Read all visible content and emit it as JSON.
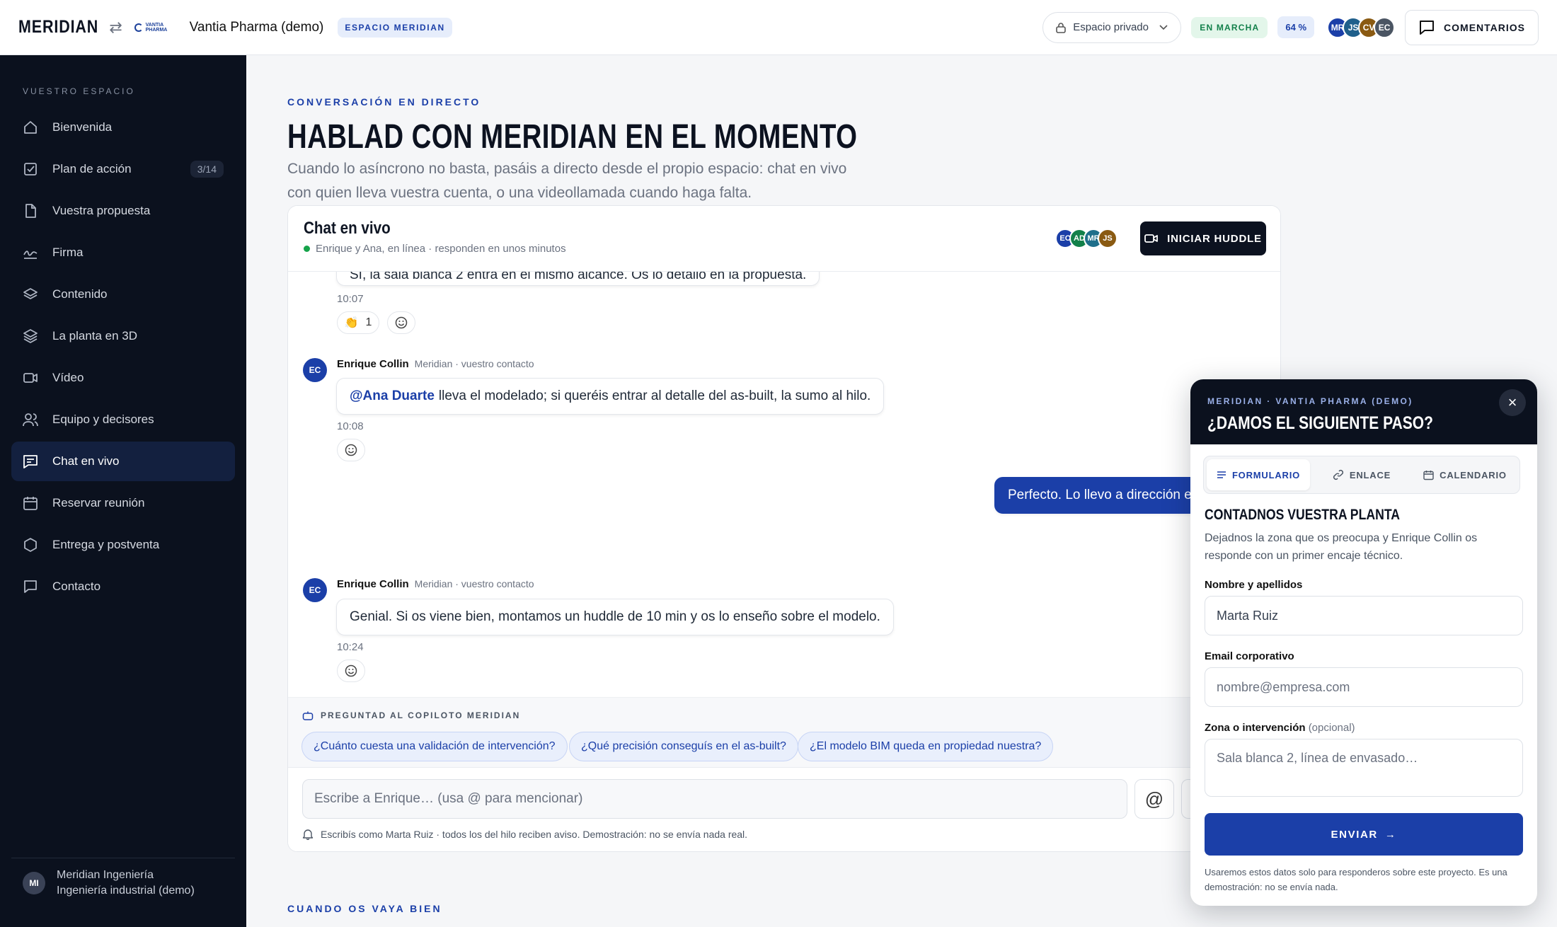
{
  "topbar": {
    "brand": "MERIDIAN",
    "client_logo_text": "VANTIA PHARMA",
    "client_name": "Vantia Pharma (demo)",
    "space_badge": "ESPACIO MERIDIAN",
    "space_selector": "Espacio privado",
    "status": "EN MARCHA",
    "progress": "64 %",
    "avatars": [
      {
        "initials": "MR",
        "color": "#1b3fa8"
      },
      {
        "initials": "JS",
        "color": "#1f5f8b"
      },
      {
        "initials": "CV",
        "color": "#8a5a12"
      },
      {
        "initials": "EC",
        "color": "#4b5563"
      }
    ],
    "comments_label": "COMENTARIOS"
  },
  "sidebar": {
    "section_label": "VUESTRO ESPACIO",
    "items": [
      {
        "label": "Bienvenida",
        "icon": "home-icon"
      },
      {
        "label": "Plan de acción",
        "icon": "checklist-icon",
        "count": "3/14"
      },
      {
        "label": "Vuestra propuesta",
        "icon": "document-icon"
      },
      {
        "label": "Firma",
        "icon": "signature-icon"
      },
      {
        "label": "Contenido",
        "icon": "layers-icon"
      },
      {
        "label": "La planta en 3D",
        "icon": "stack-icon"
      },
      {
        "label": "Vídeo",
        "icon": "video-icon"
      },
      {
        "label": "Equipo y decisores",
        "icon": "users-icon"
      },
      {
        "label": "Chat en vivo",
        "icon": "chat-icon",
        "active": true
      },
      {
        "label": "Reservar reunión",
        "icon": "calendar-icon"
      },
      {
        "label": "Entrega y postventa",
        "icon": "hexagon-icon"
      },
      {
        "label": "Contacto",
        "icon": "message-icon"
      }
    ],
    "user": {
      "initials": "MI",
      "line1": "Meridian Ingeniería",
      "line2": "Ingeniería industrial (demo)"
    }
  },
  "main": {
    "eyebrow": "CONVERSACIÓN EN DIRECTO",
    "title": "HABLAD CON MERIDIAN EN EL MOMENTO",
    "lead": "Cuando lo asíncrono no basta, pasáis a directo desde el propio espacio: chat en vivo con quien lleva vuestra cuenta, o una videollamada cuando haga falta.",
    "eyebrow2": "CUANDO OS VAYA BIEN"
  },
  "chat": {
    "title": "Chat en vivo",
    "subtitle": "Enrique y Ana, en línea · responden en unos minutos",
    "head_avatars": [
      {
        "initials": "EC",
        "color": "#1b3fa8"
      },
      {
        "initials": "AD",
        "color": "#12804a"
      },
      {
        "initials": "MR",
        "color": "#1f6f8b"
      },
      {
        "initials": "JS",
        "color": "#8a5a12"
      }
    ],
    "huddle_label": "INICIAR HUDDLE",
    "messages": {
      "m1": {
        "text": "Sí, la sala blanca 2 entra en el mismo alcance. Os lo detallo en la propuesta.",
        "time": "10:07",
        "reaction_emoji": "👏",
        "reaction_count": "1"
      },
      "m2": {
        "initials": "EC",
        "author": "Enrique Collin",
        "role": "Meridian · vuestro contacto",
        "mention": "@Ana Duarte",
        "text": "lleva el modelado; si queréis entrar al detalle del as-built, la sumo al hilo.",
        "time": "10:08"
      },
      "m3": {
        "text": "Perfecto. Lo llevo a dirección esta semana."
      },
      "m4": {
        "initials": "EC",
        "author": "Enrique Collin",
        "role": "Meridian · vuestro contacto",
        "text": "Genial. Si os viene bien, montamos un huddle de 10 min y os lo enseño sobre el modelo.",
        "time": "10:24"
      }
    },
    "copilot": {
      "label": "PREGUNTAD AL COPILOTO MERIDIAN",
      "chips": [
        "¿Cuánto cuesta una validación de intervención?",
        "¿Qué precisión conseguís en el as-built?",
        "¿El modelo BIM queda en propiedad nuestra?"
      ]
    },
    "composer": {
      "placeholder": "Escribe a Enrique…  (usa @ para mencionar)",
      "at_symbol": "@",
      "footnote": "Escribís como Marta Ruiz · todos los del hilo reciben aviso. Demostración: no se envía nada real."
    }
  },
  "panel": {
    "eyebrow": "MERIDIAN · VANTIA PHARMA (DEMO)",
    "title": "¿DAMOS EL SIGUIENTE PASO?",
    "close": "×",
    "tabs": [
      "FORMULARIO",
      "ENLACE",
      "CALENDARIO"
    ],
    "heading": "CONTADNOS VUESTRA PLANTA",
    "description": "Dejadnos la zona que os preocupa y Enrique Collin os responde con un primer encaje técnico.",
    "fields": {
      "name": {
        "label": "Nombre y apellidos",
        "value": "Marta Ruiz"
      },
      "email": {
        "label": "Email corporativo",
        "placeholder": "nombre@empresa.com"
      },
      "zone": {
        "label": "Zona o intervención",
        "optional": "(opcional)",
        "placeholder": "Sala blanca 2, línea de envasado…"
      }
    },
    "submit": "ENVIAR",
    "submit_arrow": "→",
    "note": "Usaremos estos datos solo para responderos sobre este proyecto. Es una demostración: no se envía nada."
  }
}
